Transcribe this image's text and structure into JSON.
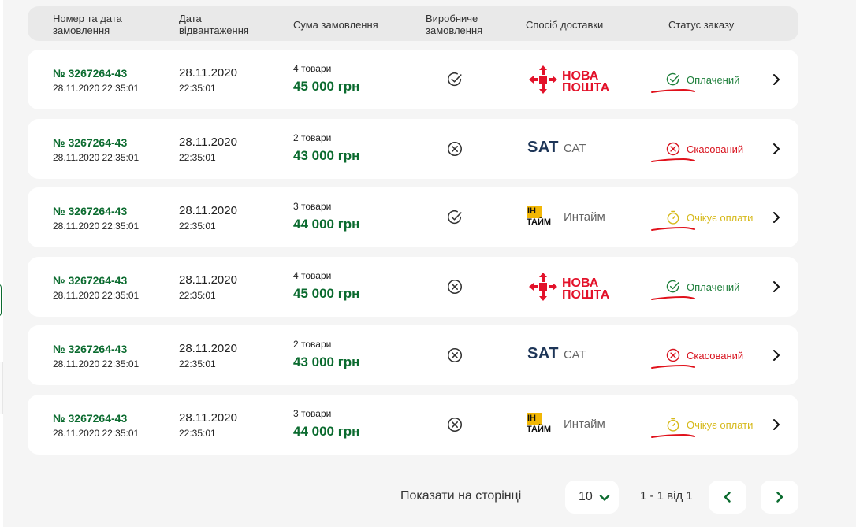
{
  "header": {
    "order_label": "Номер та дата замовлення",
    "ship_label": "Дата відвантаження",
    "sum_label": "Сума замовлення",
    "production_label": "Виробниче замовлення",
    "delivery_label": "Спосіб доставки",
    "status_label": "Статус заказу"
  },
  "orders": [
    {
      "number": "№ 3267264-43",
      "created": "28.11.2020 22:35:01",
      "ship_date": "28.11.2020",
      "ship_time": "22:35:01",
      "items": "4 товари",
      "total": "45 000 грн",
      "production": "check-circle-icon",
      "carrier": "nova",
      "carrier_line1": "НОВА",
      "carrier_line2": "ПОШТА",
      "status": "Оплачений",
      "status_type": "paid"
    },
    {
      "number": "№ 3267264-43",
      "created": "28.11.2020 22:35:01",
      "ship_date": "28.11.2020",
      "ship_time": "22:35:01",
      "items": "2 товари",
      "total": "43 000 грн",
      "production": "x-circle-icon",
      "carrier": "sat",
      "carrier_logo": "SAT",
      "carrier_name": "САТ",
      "status": "Скасований",
      "status_type": "cancel"
    },
    {
      "number": "№ 3267264-43",
      "created": "28.11.2020 22:35:01",
      "ship_date": "28.11.2020",
      "ship_time": "22:35:01",
      "items": "3 товари",
      "total": "44 000 грн",
      "production": "check-circle-icon",
      "carrier": "intime",
      "carrier_logo_top": "ІН",
      "carrier_logo_bottom": "ТАЙМ",
      "carrier_name": "Интайм",
      "status": "Очікує оплати",
      "status_type": "wait"
    },
    {
      "number": "№ 3267264-43",
      "created": "28.11.2020 22:35:01",
      "ship_date": "28.11.2020",
      "ship_time": "22:35:01",
      "items": "4 товари",
      "total": "45 000 грн",
      "production": "x-circle-icon",
      "carrier": "nova",
      "carrier_line1": "НОВА",
      "carrier_line2": "ПОШТА",
      "status": "Оплачений",
      "status_type": "paid"
    },
    {
      "number": "№ 3267264-43",
      "created": "28.11.2020 22:35:01",
      "ship_date": "28.11.2020",
      "ship_time": "22:35:01",
      "items": "2 товари",
      "total": "43 000 грн",
      "production": "x-circle-icon",
      "carrier": "sat",
      "carrier_logo": "SAT",
      "carrier_name": "САТ",
      "status": "Скасований",
      "status_type": "cancel"
    },
    {
      "number": "№ 3267264-43",
      "created": "28.11.2020 22:35:01",
      "ship_date": "28.11.2020",
      "ship_time": "22:35:01",
      "items": "3 товари",
      "total": "44 000 грн",
      "production": "x-circle-icon",
      "carrier": "intime",
      "carrier_logo_top": "ІН",
      "carrier_logo_bottom": "ТАЙМ",
      "carrier_name": "Интайм",
      "status": "Очікує оплати",
      "status_type": "wait"
    }
  ],
  "pagination": {
    "per_page_label": "Показати на сторінці",
    "per_page_value": "10",
    "range": "1 - 1 від 1"
  },
  "colors": {
    "brand_green": "#0b6b2f",
    "paid": "#1e7f3b",
    "cancel": "#d8141f",
    "wait": "#d6b91a",
    "nova": "#e3122a",
    "sat": "#1d3557"
  }
}
